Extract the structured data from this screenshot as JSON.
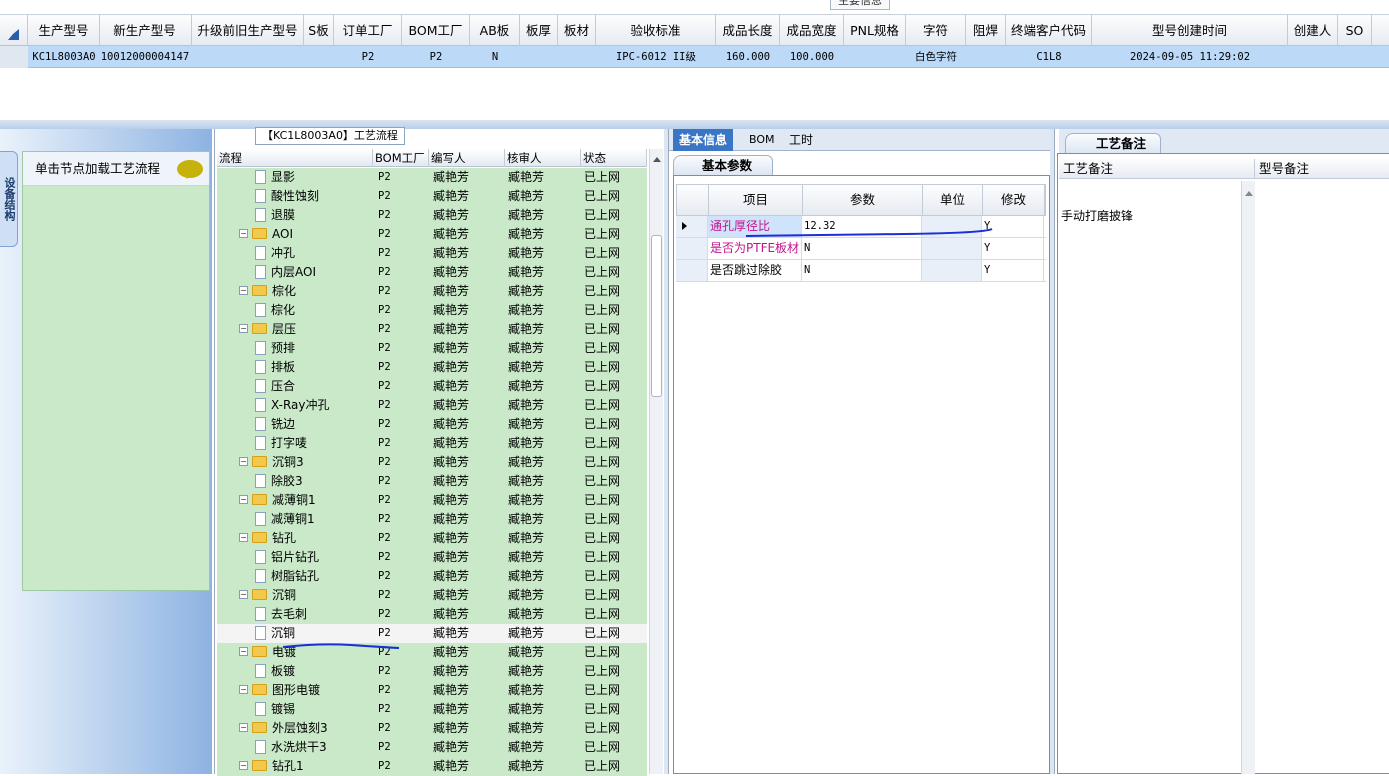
{
  "top_grid": {
    "tab_label": "主要信息",
    "columns": [
      "生产型号",
      "新生产型号",
      "升级前旧生产型号",
      "S板",
      "订单工厂",
      "BOM工厂",
      "AB板",
      "板厚",
      "板材",
      "验收标准",
      "成品长度",
      "成品宽度",
      "PNL规格",
      "字符",
      "阻焊",
      "终端客户代码",
      "型号创建时间",
      "创建人",
      "SO"
    ],
    "row": [
      "KC1L8003A0",
      "10012000004147",
      "",
      "",
      "P2",
      "P2",
      "N",
      "",
      "",
      "IPC-6012 II级",
      "160.000",
      "100.000",
      "",
      "白色字符",
      "",
      "C1L8",
      "2024-09-05 11:29:02",
      "",
      ""
    ]
  },
  "left_panel": {
    "vertical_tab": "设备结构",
    "load_hint": "单击节点加载工艺流程"
  },
  "tree": {
    "title": "【KC1L8003A0】工艺流程",
    "columns": [
      "流程",
      "BOM工厂",
      "编写人",
      "核审人",
      "状态"
    ],
    "rows": [
      {
        "name": "显影",
        "level": 2,
        "folder": false,
        "bom": "P2",
        "writer": "臧艳芳",
        "reviewer": "臧艳芳",
        "status": "已上网"
      },
      {
        "name": "酸性蚀刻",
        "level": 2,
        "folder": false,
        "bom": "P2",
        "writer": "臧艳芳",
        "reviewer": "臧艳芳",
        "status": "已上网"
      },
      {
        "name": "退膜",
        "level": 2,
        "folder": false,
        "bom": "P2",
        "writer": "臧艳芳",
        "reviewer": "臧艳芳",
        "status": "已上网"
      },
      {
        "name": "AOI",
        "level": 1,
        "folder": true,
        "bom": "P2",
        "writer": "臧艳芳",
        "reviewer": "臧艳芳",
        "status": "已上网"
      },
      {
        "name": "冲孔",
        "level": 2,
        "folder": false,
        "bom": "P2",
        "writer": "臧艳芳",
        "reviewer": "臧艳芳",
        "status": "已上网"
      },
      {
        "name": "内层AOI",
        "level": 2,
        "folder": false,
        "bom": "P2",
        "writer": "臧艳芳",
        "reviewer": "臧艳芳",
        "status": "已上网"
      },
      {
        "name": "棕化",
        "level": 1,
        "folder": true,
        "bom": "P2",
        "writer": "臧艳芳",
        "reviewer": "臧艳芳",
        "status": "已上网"
      },
      {
        "name": "棕化",
        "level": 2,
        "folder": false,
        "bom": "P2",
        "writer": "臧艳芳",
        "reviewer": "臧艳芳",
        "status": "已上网"
      },
      {
        "name": "层压",
        "level": 1,
        "folder": true,
        "bom": "P2",
        "writer": "臧艳芳",
        "reviewer": "臧艳芳",
        "status": "已上网"
      },
      {
        "name": "预排",
        "level": 2,
        "folder": false,
        "bom": "P2",
        "writer": "臧艳芳",
        "reviewer": "臧艳芳",
        "status": "已上网"
      },
      {
        "name": "排板",
        "level": 2,
        "folder": false,
        "bom": "P2",
        "writer": "臧艳芳",
        "reviewer": "臧艳芳",
        "status": "已上网"
      },
      {
        "name": "压合",
        "level": 2,
        "folder": false,
        "bom": "P2",
        "writer": "臧艳芳",
        "reviewer": "臧艳芳",
        "status": "已上网"
      },
      {
        "name": "X-Ray冲孔",
        "level": 2,
        "folder": false,
        "bom": "P2",
        "writer": "臧艳芳",
        "reviewer": "臧艳芳",
        "status": "已上网"
      },
      {
        "name": "铣边",
        "level": 2,
        "folder": false,
        "bom": "P2",
        "writer": "臧艳芳",
        "reviewer": "臧艳芳",
        "status": "已上网"
      },
      {
        "name": "打字唛",
        "level": 2,
        "folder": false,
        "bom": "P2",
        "writer": "臧艳芳",
        "reviewer": "臧艳芳",
        "status": "已上网"
      },
      {
        "name": "沉铜3",
        "level": 1,
        "folder": true,
        "bom": "P2",
        "writer": "臧艳芳",
        "reviewer": "臧艳芳",
        "status": "已上网"
      },
      {
        "name": "除胶3",
        "level": 2,
        "folder": false,
        "bom": "P2",
        "writer": "臧艳芳",
        "reviewer": "臧艳芳",
        "status": "已上网"
      },
      {
        "name": "减薄铜1",
        "level": 1,
        "folder": true,
        "bom": "P2",
        "writer": "臧艳芳",
        "reviewer": "臧艳芳",
        "status": "已上网"
      },
      {
        "name": "减薄铜1",
        "level": 2,
        "folder": false,
        "bom": "P2",
        "writer": "臧艳芳",
        "reviewer": "臧艳芳",
        "status": "已上网"
      },
      {
        "name": "钻孔",
        "level": 1,
        "folder": true,
        "bom": "P2",
        "writer": "臧艳芳",
        "reviewer": "臧艳芳",
        "status": "已上网"
      },
      {
        "name": "铝片钻孔",
        "level": 2,
        "folder": false,
        "bom": "P2",
        "writer": "臧艳芳",
        "reviewer": "臧艳芳",
        "status": "已上网"
      },
      {
        "name": "树脂钻孔",
        "level": 2,
        "folder": false,
        "bom": "P2",
        "writer": "臧艳芳",
        "reviewer": "臧艳芳",
        "status": "已上网"
      },
      {
        "name": "沉铜",
        "level": 1,
        "folder": true,
        "bom": "P2",
        "writer": "臧艳芳",
        "reviewer": "臧艳芳",
        "status": "已上网"
      },
      {
        "name": "去毛刺",
        "level": 2,
        "folder": false,
        "bom": "P2",
        "writer": "臧艳芳",
        "reviewer": "臧艳芳",
        "status": "已上网"
      },
      {
        "name": "沉铜",
        "level": 2,
        "folder": false,
        "bom": "P2",
        "writer": "臧艳芳",
        "reviewer": "臧艳芳",
        "status": "已上网",
        "selected": true
      },
      {
        "name": "电镀",
        "level": 1,
        "folder": true,
        "bom": "P2",
        "writer": "臧艳芳",
        "reviewer": "臧艳芳",
        "status": "已上网"
      },
      {
        "name": "板镀",
        "level": 2,
        "folder": false,
        "bom": "P2",
        "writer": "臧艳芳",
        "reviewer": "臧艳芳",
        "status": "已上网"
      },
      {
        "name": "图形电镀",
        "level": 1,
        "folder": true,
        "bom": "P2",
        "writer": "臧艳芳",
        "reviewer": "臧艳芳",
        "status": "已上网"
      },
      {
        "name": "镀锡",
        "level": 2,
        "folder": false,
        "bom": "P2",
        "writer": "臧艳芳",
        "reviewer": "臧艳芳",
        "status": "已上网"
      },
      {
        "name": "外层蚀刻3",
        "level": 1,
        "folder": true,
        "bom": "P2",
        "writer": "臧艳芳",
        "reviewer": "臧艳芳",
        "status": "已上网"
      },
      {
        "name": "水洗烘干3",
        "level": 2,
        "folder": false,
        "bom": "P2",
        "writer": "臧艳芳",
        "reviewer": "臧艳芳",
        "status": "已上网"
      },
      {
        "name": "钻孔1",
        "level": 1,
        "folder": true,
        "bom": "P2",
        "writer": "臧艳芳",
        "reviewer": "臧艳芳",
        "status": "已上网"
      }
    ]
  },
  "middle": {
    "tabs": [
      "基本信息",
      "BOM",
      "工时"
    ],
    "active_tab": "基本信息",
    "subtab": "基本参数",
    "columns": [
      "项目",
      "参数",
      "单位",
      "修改"
    ],
    "rows": [
      {
        "item": "通孔厚径比",
        "value": "12.32",
        "unit": "",
        "edit": "Y",
        "highlight": true
      },
      {
        "item": "是否为PTFE板材",
        "value": "N",
        "unit": "",
        "edit": "Y",
        "highlight": true
      },
      {
        "item": "是否跳过除胶",
        "value": "N",
        "unit": "",
        "edit": "Y",
        "highlight": false
      }
    ]
  },
  "right": {
    "tab": "工艺备注",
    "columns": [
      "工艺备注",
      "型号备注"
    ],
    "process_note": "手动打磨披锋"
  },
  "colors": {
    "tree_bg": "#c9e9c9",
    "accent": "#3a76c5",
    "highlight_text": "#c4148c",
    "annotation_line": "#1a2fd6"
  }
}
